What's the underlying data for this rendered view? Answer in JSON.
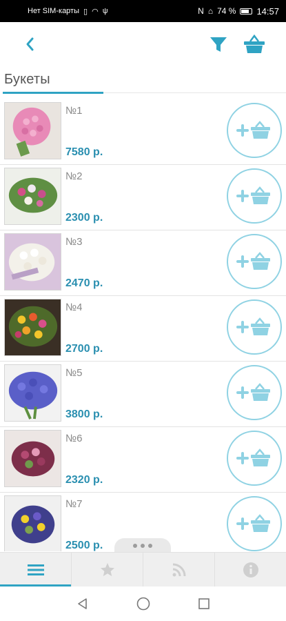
{
  "status_bar": {
    "carrier": "Нет SIM-карты",
    "battery_percent": "74 %",
    "time": "14:57"
  },
  "header": {
    "back_icon": "chevron-left-icon",
    "filter_icon": "filter-icon",
    "basket_icon": "basket-icon"
  },
  "section": {
    "title": "Букеты"
  },
  "items": [
    {
      "name": "№1",
      "price": "7580 р."
    },
    {
      "name": "№2",
      "price": "2300 р."
    },
    {
      "name": "№3",
      "price": "2470 р."
    },
    {
      "name": "№4",
      "price": "2700 р."
    },
    {
      "name": "№5",
      "price": "3800 р."
    },
    {
      "name": "№6",
      "price": "2320 р."
    },
    {
      "name": "№7",
      "price": "2500 р."
    }
  ],
  "tabs": [
    {
      "icon": "list-icon",
      "active": true
    },
    {
      "icon": "star-icon",
      "active": false
    },
    {
      "icon": "rss-icon",
      "active": false
    },
    {
      "icon": "info-icon",
      "active": false
    }
  ],
  "colors": {
    "accent": "#2fa3c3",
    "price": "#2a8fb0",
    "button_ring": "#8fd2e3"
  }
}
